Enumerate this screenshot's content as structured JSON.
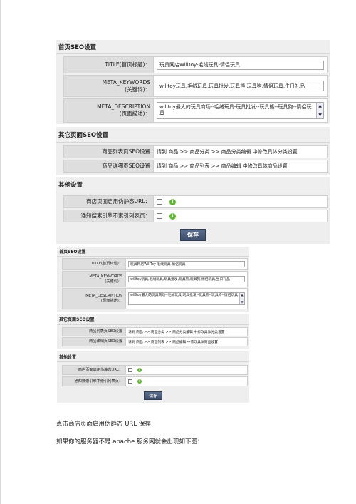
{
  "seo_home": {
    "title": "首页SEO设置",
    "title_label": "TITLE(首页标题)：",
    "title_value": "玩具网店WillToy-毛绒玩具-情侣玩具",
    "keywords_label_1": "META_KEYWORDS",
    "keywords_label_2": "(关键词)：",
    "keywords_value": "willtoy玩具,毛绒玩具,玩具批发,玩具熊,玩具狗,情侣玩具,生日礼品",
    "desc_label_1": "META_DESCRIPTION",
    "desc_label_2": "(页面描述)：",
    "desc_value": "willtoy最大的玩具商场--毛绒玩具-玩具批发--玩具熊--玩具狗--情侣玩具"
  },
  "seo_other": {
    "title": "其它页面SEO设置",
    "list_label": "商品列表页SEO设置",
    "list_value": "请到  商品  >> 商品分类  >> 商品分类编辑  中修改具体分类设置",
    "detail_label": "商品详细页SEO设置",
    "detail_value": "请到  商品  >> 商品列表  >> 商品编辑  中修改具体商品设置"
  },
  "seo_misc": {
    "title": "其他设置",
    "static_label": "商店页面启用伪静态URL：",
    "noindex_label": "通知搜索引擎不索引列表页：",
    "info_symbol": "i",
    "static_checked": false,
    "noindex_checked": false
  },
  "save_label": "保存",
  "paragraph_1": "点击商店页面启用伪静态 URL  保存",
  "paragraph_2": "如果你的服务器不是 apache 服务网就会出现如下图："
}
